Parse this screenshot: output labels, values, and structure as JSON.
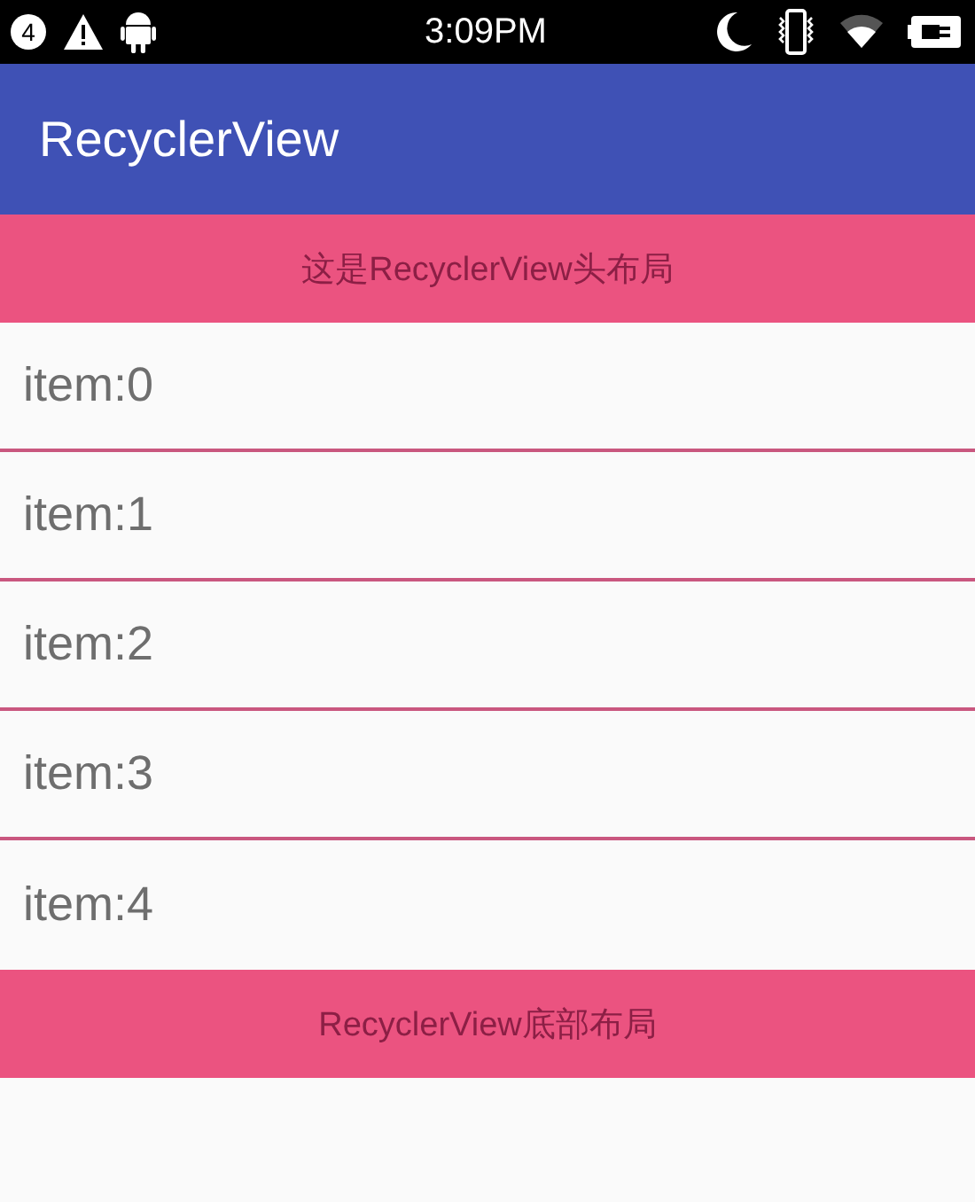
{
  "status_bar": {
    "notification_count": "4",
    "time": "3:09PM"
  },
  "app_bar": {
    "title": "RecyclerView"
  },
  "header": {
    "text": "这是RecyclerView头布局"
  },
  "items": [
    {
      "label": "item:0"
    },
    {
      "label": "item:1"
    },
    {
      "label": "item:2"
    },
    {
      "label": "item:3"
    },
    {
      "label": "item:4"
    }
  ],
  "footer": {
    "text": "RecyclerView底部布局"
  }
}
